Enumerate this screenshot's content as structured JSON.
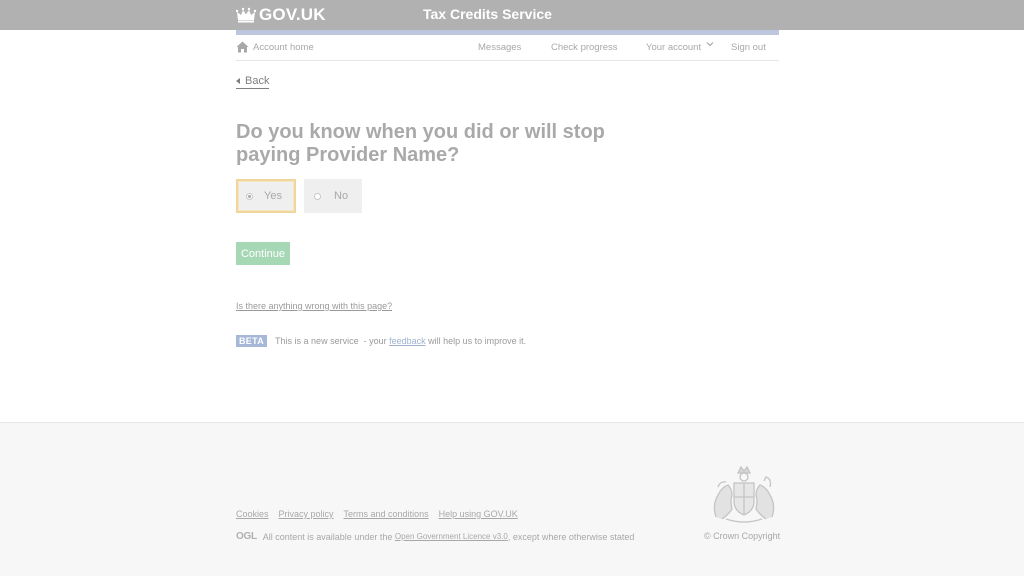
{
  "header": {
    "logo_text": "GOV.UK",
    "service_name": "Tax Credits Service",
    "colors": {
      "bar": "#b1b1b1",
      "strip": "#bcc6dc"
    }
  },
  "account_nav": {
    "home_label": "Account home",
    "messages": "Messages",
    "check_progress": "Check progress",
    "your_account": "Your account",
    "sign_out": "Sign out"
  },
  "back_link": "Back",
  "question": {
    "heading": "Do you know when you did or will stop paying Provider Name?",
    "options": [
      {
        "label": "Yes",
        "selected": true
      },
      {
        "label": "No",
        "selected": false
      }
    ]
  },
  "continue_button": "Continue",
  "report_link": "Is there anything wrong with this page?",
  "beta_banner": {
    "tag": "BETA",
    "text_before": "This is a new service  - your ",
    "feedback_link": "feedback",
    "text_after": " will help us to improve it."
  },
  "footer": {
    "links": [
      "Cookies",
      "Privacy policy",
      "Terms and conditions",
      "Help using GOV.UK"
    ],
    "ogl_logo": "OGL",
    "licence_before": "All content is available under the ",
    "licence_link": "Open Government Licence v3.0",
    "licence_after": ", except where otherwise stated",
    "copyright": "© Crown Copyright"
  },
  "icons": [
    "crown-icon",
    "home-icon",
    "chevron-down-icon",
    "back-arrow-icon",
    "royal-crest-icon"
  ]
}
